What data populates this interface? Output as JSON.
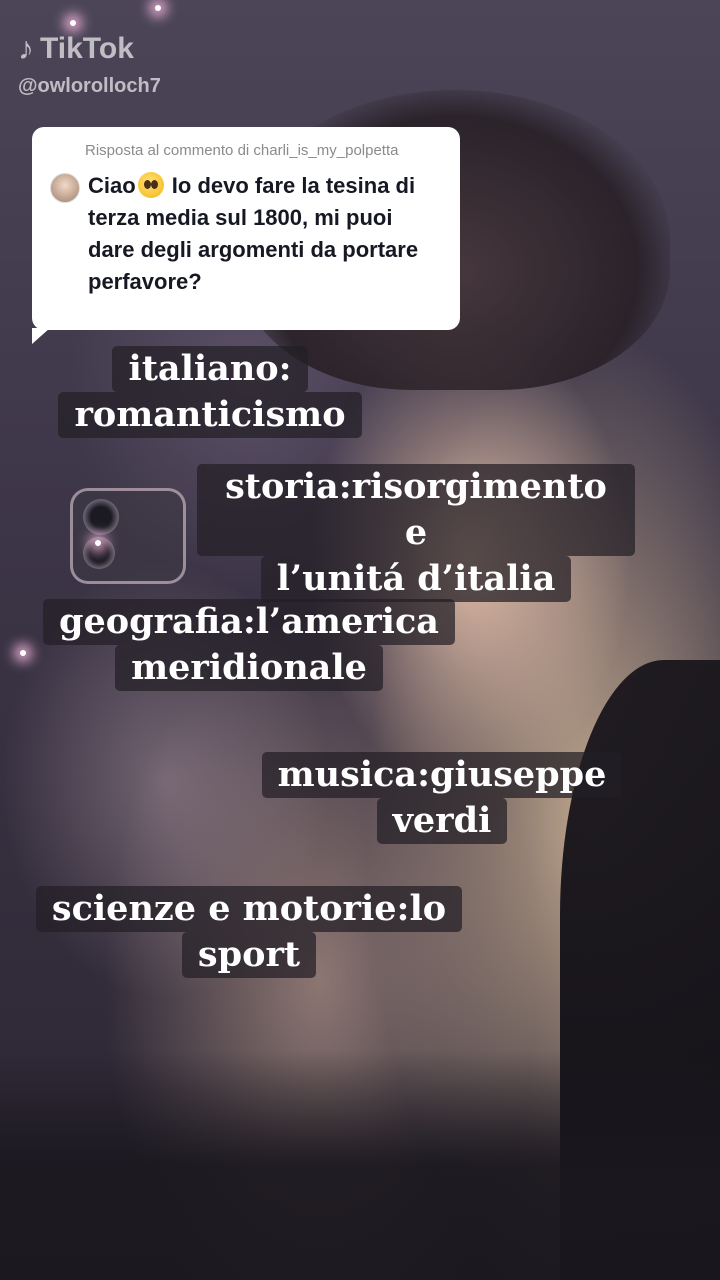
{
  "watermark": {
    "brand": "TikTok",
    "handle": "@owlorolloch7",
    "logo_icon": "tiktok-note-icon"
  },
  "reply": {
    "label": "Risposta al commento di charli_is_my_polpetta",
    "comment_before_emoji": "Ciao",
    "emoji_icon": "pleading-face-emoji",
    "comment_after_emoji": " Io devo fare la tesina di terza media sul 1800, mi puoi dare degli argomenti da portare perfavore?"
  },
  "captions": [
    {
      "lines": [
        "italiano:",
        "romanticismo"
      ]
    },
    {
      "lines": [
        "storia:risorgimento e",
        "l’unitá d’italia"
      ]
    },
    {
      "lines": [
        "geografia:l’america",
        "meridionale"
      ]
    },
    {
      "lines": [
        "musica:giuseppe",
        "verdi"
      ]
    },
    {
      "lines": [
        "scienze e motorie:lo",
        "sport"
      ]
    }
  ]
}
